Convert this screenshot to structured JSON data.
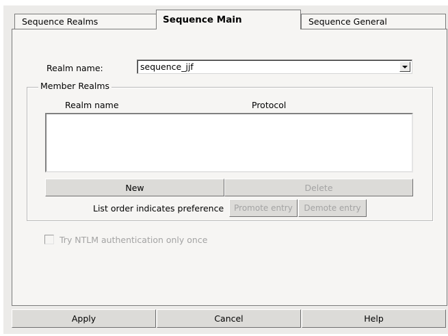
{
  "tabs": [
    {
      "label": "Sequence Realms"
    },
    {
      "label": "Sequence Main"
    },
    {
      "label": "Sequence General"
    }
  ],
  "realm_name": {
    "label": "Realm name:",
    "value": "sequence_jjf"
  },
  "member_realms": {
    "legend": "Member Realms",
    "columns": [
      "Realm name",
      "Protocol"
    ],
    "rows": []
  },
  "buttons": {
    "new": "New",
    "delete": "Delete",
    "promote": "Promote entry",
    "demote": "Demote entry",
    "apply": "Apply",
    "cancel": "Cancel",
    "help": "Help"
  },
  "list_order_note": "List order indicates preference",
  "ntlm_checkbox": {
    "label": "Try NTLM authentication only once",
    "checked": false,
    "enabled": false
  },
  "icons": {
    "combo_arrow": "chevron-down-icon"
  }
}
